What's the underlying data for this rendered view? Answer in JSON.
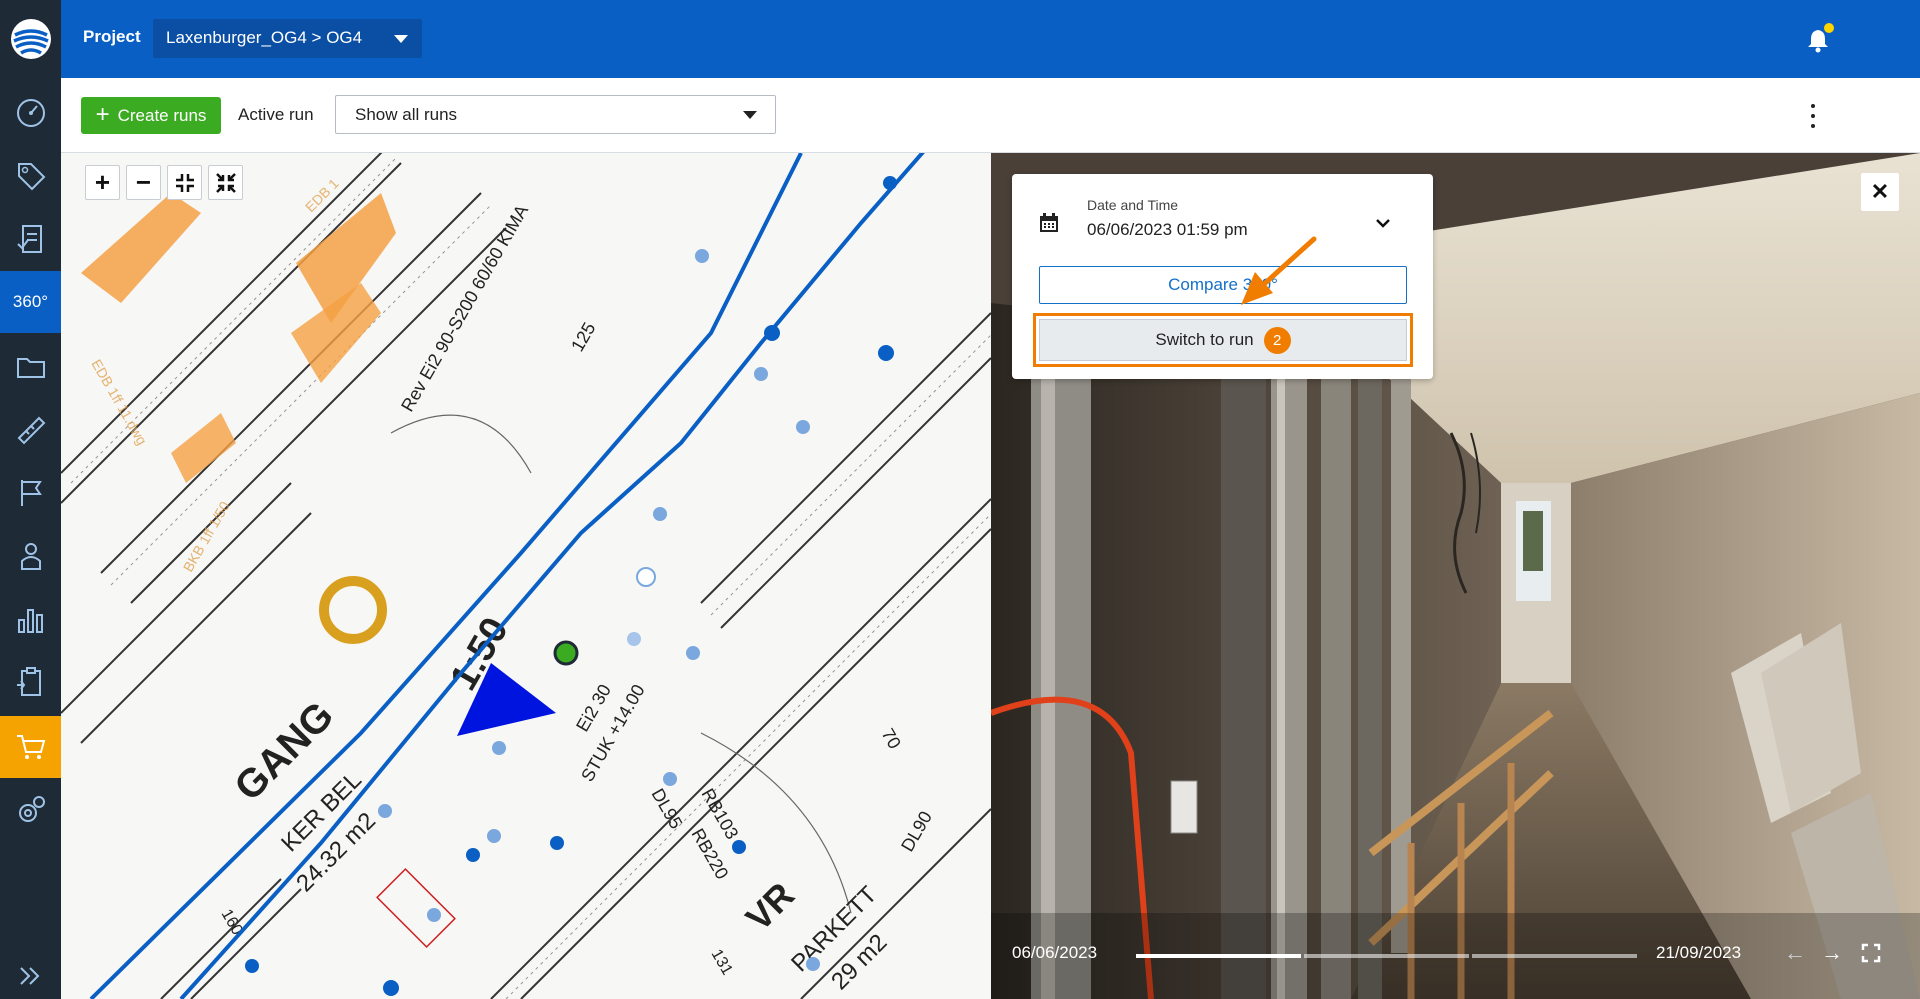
{
  "header": {
    "project_label": "Project",
    "project_selector": "Laxenburger_OG4 > OG4"
  },
  "sidebar": {
    "items": [
      {
        "name": "dashboard-icon"
      },
      {
        "name": "tag-icon"
      },
      {
        "name": "checklist-icon"
      },
      {
        "name": "360",
        "label": "360°",
        "active": true
      },
      {
        "name": "folder-icon"
      },
      {
        "name": "measure-icon"
      },
      {
        "name": "flag-icon"
      },
      {
        "name": "person-icon"
      },
      {
        "name": "chart-icon"
      },
      {
        "name": "clipboard-icon"
      },
      {
        "name": "cart-icon",
        "active": true
      },
      {
        "name": "settings-icon"
      },
      {
        "name": "expand-icon"
      }
    ]
  },
  "toolbar": {
    "create_runs": "Create runs",
    "active_run_label": "Active run",
    "runs_select_value": "Show all runs"
  },
  "map": {
    "zoom_in": "+",
    "zoom_out": "−"
  },
  "panel": {
    "date_label": "Date and Time",
    "date_value": "06/06/2023 01:59 pm",
    "compare_label": "Compare 360°",
    "switch_label": "Switch to run",
    "step_number": "2"
  },
  "timeline": {
    "start": "06/06/2023",
    "end": "21/09/2023"
  },
  "colors": {
    "brand_blue": "#0a5fc4",
    "sidebar_bg": "#1f2a37",
    "create_green": "#3bab22",
    "highlight_orange": "#f07d00",
    "cart_active": "#f5a300"
  }
}
